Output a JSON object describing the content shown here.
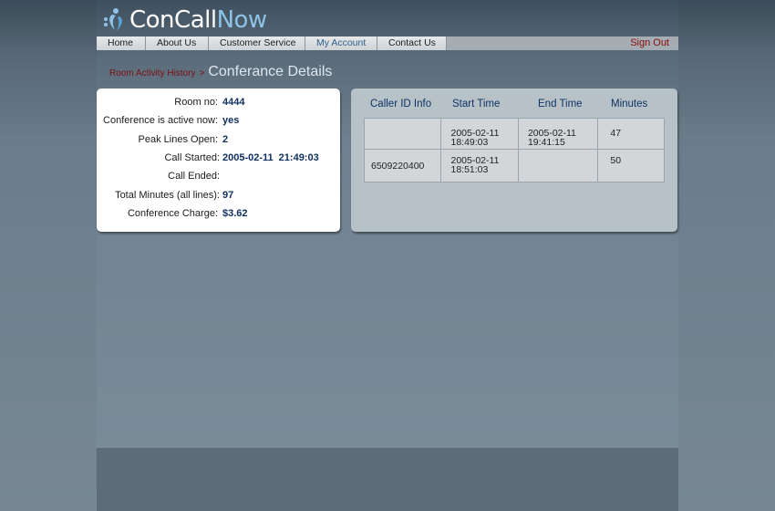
{
  "logo": {
    "part1": "ConCall",
    "part2": "Now"
  },
  "nav": {
    "items": [
      "Home",
      "About Us",
      "Customer Service",
      "My Account",
      "Contact Us"
    ],
    "active_index": 3,
    "signout": "Sign Out"
  },
  "breadcrumb": {
    "link": "Room Activity History",
    "separator": ">",
    "title": "Conferance Details"
  },
  "info": [
    {
      "label": "Room no:",
      "value": "4444"
    },
    {
      "label": "Conference is active now:",
      "value": "yes"
    },
    {
      "label": "Peak Lines Open:",
      "value": "2"
    },
    {
      "label": "Call Started:",
      "value_date": "2005-02-11",
      "value_time": "21:49:03"
    },
    {
      "label": "Call Ended:",
      "value": ""
    },
    {
      "label": "Total Minutes (all lines):",
      "value": "97"
    },
    {
      "label": "Conference Charge:",
      "value": "$3.62"
    }
  ],
  "calls": {
    "headers": [
      "Caller ID Info",
      "Start Time",
      "End Time",
      "Minutes"
    ],
    "rows": [
      {
        "caller_id": "",
        "start_date": "2005-02-11",
        "start_time": "18:49:03",
        "end_date": "2005-02-11",
        "end_time": "19:41:15",
        "minutes": "47"
      },
      {
        "caller_id": "6509220400",
        "start_date": "2005-02-11",
        "start_time": "18:51:03",
        "end_date": "",
        "end_time": "",
        "minutes": "50"
      }
    ]
  },
  "colors": {
    "accent": "#0e2f5e",
    "signout": "#8b0d0d",
    "brand_blue": "#8fc3e6"
  }
}
